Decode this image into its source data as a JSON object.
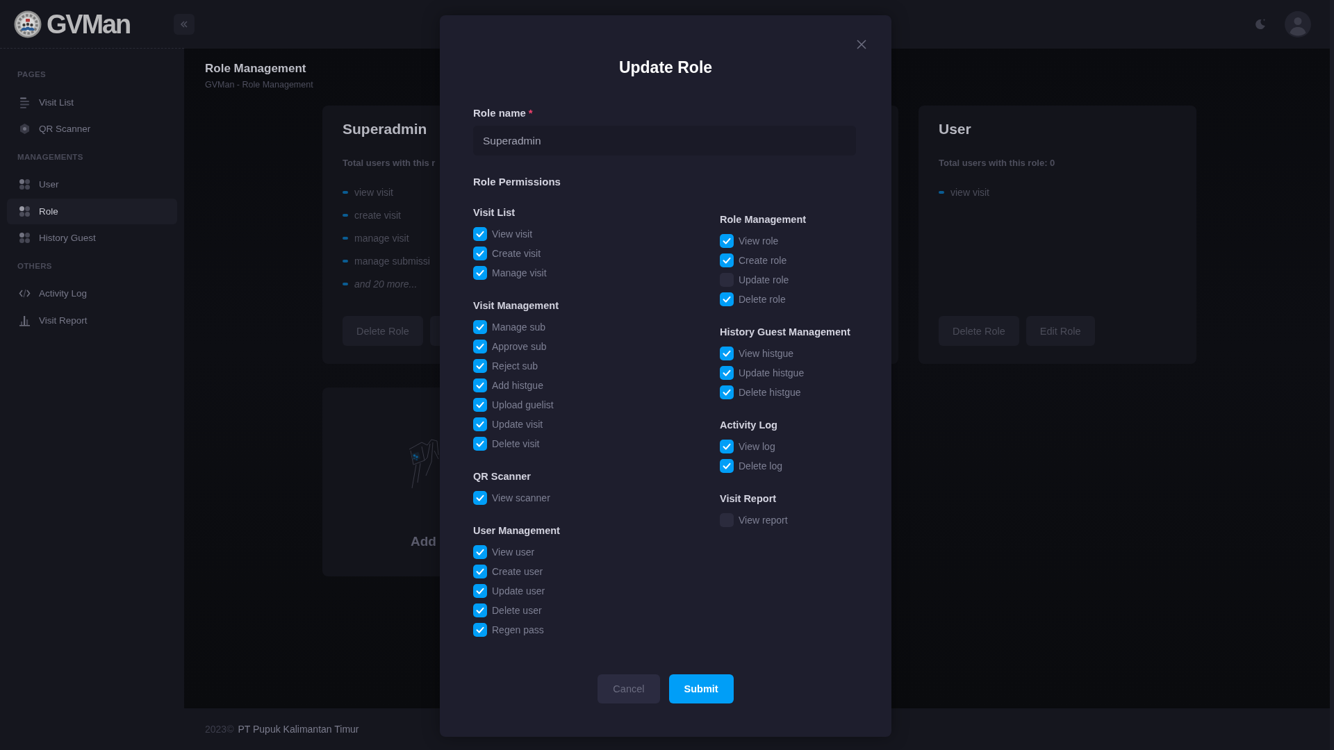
{
  "header": {
    "logo_text": "GVMan"
  },
  "sidebar": {
    "sections": [
      {
        "title": "PAGES",
        "items": [
          {
            "label": "Visit List",
            "selected": false
          },
          {
            "label": "QR Scanner",
            "selected": false
          }
        ]
      },
      {
        "title": "MANAGEMENTS",
        "items": [
          {
            "label": "User",
            "selected": false
          },
          {
            "label": "Role",
            "selected": true
          },
          {
            "label": "History Guest",
            "selected": false
          }
        ]
      },
      {
        "title": "OTHERS",
        "items": [
          {
            "label": "Activity Log",
            "selected": false
          },
          {
            "label": "Visit Report",
            "selected": false
          }
        ]
      }
    ]
  },
  "page": {
    "title": "Role Management",
    "breadcrumb": "GVMan - Role Management"
  },
  "role_cards": [
    {
      "kind": "role",
      "title": "Superadmin",
      "summary": "Total users with this r",
      "permissions": [
        {
          "kind": "permission",
          "label": "view visit"
        },
        {
          "kind": "permission",
          "label": "create visit"
        },
        {
          "kind": "permission",
          "label": "manage visit"
        },
        {
          "kind": "permission",
          "label": "manage submissi"
        },
        {
          "kind": "more",
          "label": "and 20 more..."
        }
      ],
      "buttons": [
        {
          "kind": "labeled",
          "label": "Delete Role"
        },
        {
          "kind": "covered"
        }
      ]
    },
    {
      "kind": "covered"
    },
    {
      "kind": "role",
      "title": "User",
      "summary": "Total users with this role: 0",
      "permissions": [
        {
          "kind": "permission",
          "label": "view visit"
        }
      ],
      "buttons": [
        {
          "kind": "labeled",
          "label": "Delete Role"
        },
        {
          "kind": "labeled",
          "label": "Edit Role"
        }
      ]
    },
    {
      "kind": "add",
      "label": "Add"
    }
  ],
  "footer": {
    "year": "2023©",
    "company": "PT Pupuk Kalimantan Timur"
  },
  "dialog": {
    "title": "Update Role",
    "role_name": {
      "label": "Role name",
      "required_mark": "*",
      "value": "Superadmin"
    },
    "permissions_title": "Role Permissions",
    "columns": [
      {
        "groups": [
          {
            "title": "Visit List",
            "items": [
              {
                "label": "View visit",
                "checked": true
              },
              {
                "label": "Create visit",
                "checked": true
              },
              {
                "label": "Manage visit",
                "checked": true
              }
            ]
          },
          {
            "title": "Visit Management",
            "items": [
              {
                "label": "Manage sub",
                "checked": true
              },
              {
                "label": "Approve sub",
                "checked": true
              },
              {
                "label": "Reject sub",
                "checked": true
              },
              {
                "label": "Add histgue",
                "checked": true
              },
              {
                "label": "Upload guelist",
                "checked": true
              },
              {
                "label": "Update visit",
                "checked": true
              },
              {
                "label": "Delete visit",
                "checked": true
              }
            ]
          },
          {
            "title": "QR Scanner",
            "items": [
              {
                "label": "View scanner",
                "checked": true
              }
            ]
          },
          {
            "title": "User Management",
            "items": [
              {
                "label": "View user",
                "checked": true
              },
              {
                "label": "Create user",
                "checked": true
              },
              {
                "label": "Update user",
                "checked": true
              },
              {
                "label": "Delete user",
                "checked": true
              },
              {
                "label": "Regen pass",
                "checked": true
              }
            ]
          }
        ]
      },
      {
        "groups": [
          {
            "title": "Role Management",
            "items": [
              {
                "label": "View role",
                "checked": true
              },
              {
                "label": "Create role",
                "checked": true
              },
              {
                "label": "Update role",
                "checked": false
              },
              {
                "label": "Delete role",
                "checked": true
              }
            ]
          },
          {
            "title": "History Guest Management",
            "items": [
              {
                "label": "View histgue",
                "checked": true
              },
              {
                "label": "Update histgue",
                "checked": true
              },
              {
                "label": "Delete histgue",
                "checked": true
              }
            ]
          },
          {
            "title": "Activity Log",
            "items": [
              {
                "label": "View log",
                "checked": true
              },
              {
                "label": "Delete log",
                "checked": true
              }
            ]
          },
          {
            "title": "Visit Report",
            "items": [
              {
                "label": "View report",
                "checked": false
              }
            ]
          }
        ]
      }
    ],
    "buttons": [
      {
        "kind": "secondary",
        "label": "Cancel"
      },
      {
        "kind": "primary",
        "label": "Submit"
      }
    ]
  }
}
